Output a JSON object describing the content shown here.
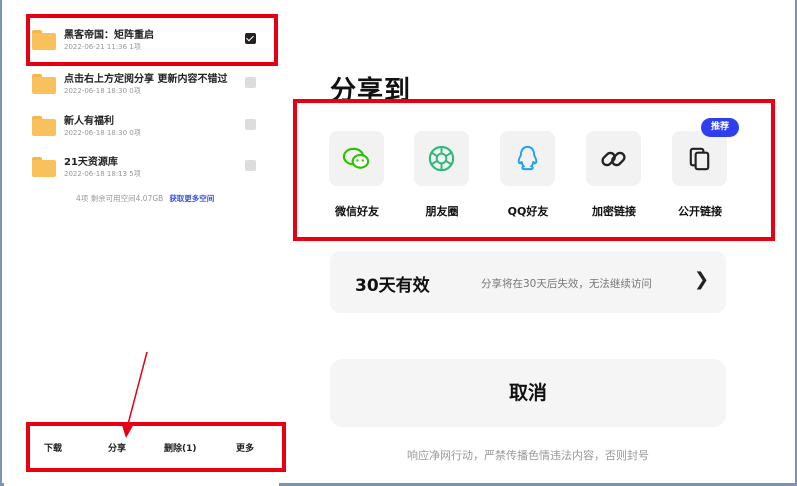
{
  "files": [
    {
      "name": "黑客帝国：矩阵重启",
      "meta": "2022-06-21 11:36  1项",
      "checked": true
    },
    {
      "name": "点击右上方定阅分享 更新内容不错过",
      "meta": "2022-06-18 18:30  0项",
      "checked": false
    },
    {
      "name": "新人有福利",
      "meta": "2022-06-18 18:30  0项",
      "checked": false
    },
    {
      "name": "21天资源库",
      "meta": "2022-06-18 18:13  5项",
      "checked": false
    }
  ],
  "storage": {
    "text": "4项  剩余可用空间4.07GB",
    "link": "获取更多空间"
  },
  "toolbar": {
    "download": "下载",
    "share": "分享",
    "delete": "删除(1)",
    "more": "更多"
  },
  "share_panel": {
    "title": "分享到",
    "badge": "推荐",
    "options": [
      {
        "label": "微信好友",
        "icon": "wechat-icon",
        "color": "#2dc100"
      },
      {
        "label": "朋友圈",
        "icon": "moments-icon",
        "color": "#2fb87a"
      },
      {
        "label": "QQ好友",
        "icon": "qq-icon",
        "color": "#1ea0f0"
      },
      {
        "label": "加密链接",
        "icon": "link-icon",
        "color": "#222222"
      },
      {
        "label": "公开链接",
        "icon": "copy-icon",
        "color": "#222222"
      }
    ],
    "validity": {
      "title": "30天有效",
      "desc": "分享将在30天后失效，无法继续访问",
      "chevron": "❯"
    },
    "cancel": "取消",
    "footer": "响应净网行动，严禁传播色情违法内容，否则封号"
  },
  "colors": {
    "annotation_red": "#e60012",
    "badge_blue": "#2f3ff0",
    "folder": "#f8c15c"
  }
}
